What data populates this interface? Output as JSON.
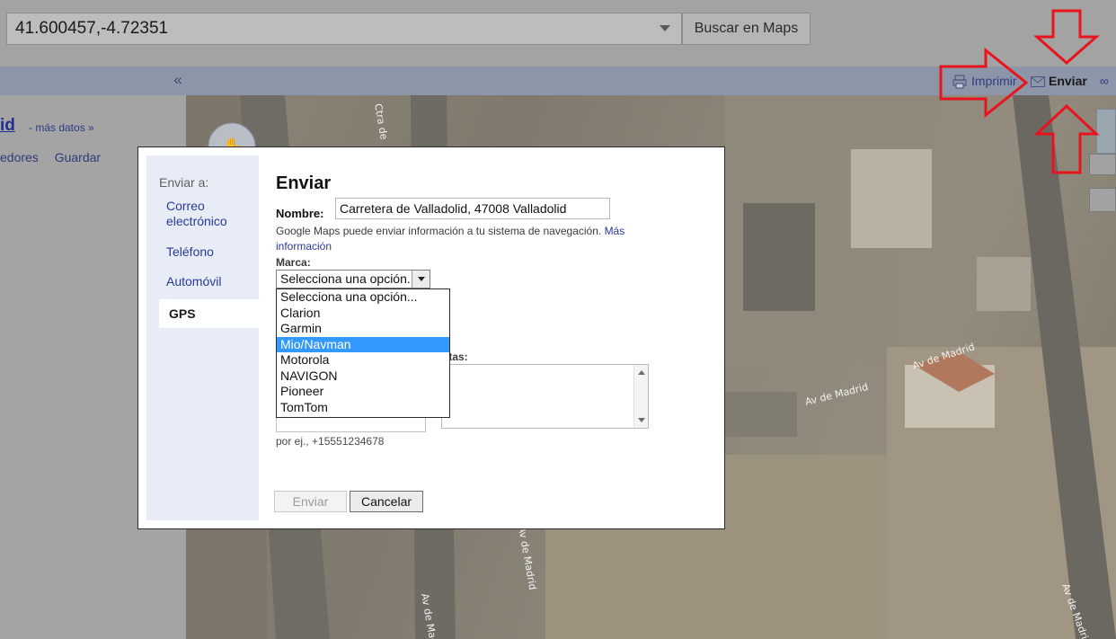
{
  "search": {
    "value": "41.600457,-4.72351",
    "button_label": "Buscar en Maps"
  },
  "sidebar": {
    "collapse_glyph": "«",
    "place_title": "id",
    "more_data_link": "- más datos »",
    "actions": [
      "edores",
      "Guardar"
    ]
  },
  "map_toolbar": {
    "print_label": "Imprimir",
    "send_label": "Enviar",
    "link_glyph": "∞"
  },
  "map_labels": [
    "Av de Madrid",
    "Av de Madrid",
    "Ctra de",
    "Av de Madrid",
    "Av de Madrid",
    "Av de Madrid"
  ],
  "dialog": {
    "title": "Enviar",
    "nav_heading": "Enviar a:",
    "nav_items": [
      "Correo electrónico",
      "Teléfono",
      "Automóvil",
      "GPS"
    ],
    "name_label": "Nombre:",
    "name_value": "Carretera de Valladolid, 47008 Valladolid",
    "info_text": "Google Maps puede enviar información a tu sistema de navegación.",
    "info_link": "Más información",
    "brand_label": "Marca:",
    "brand_selected": "Selecciona una opción...",
    "brand_options": [
      "Selecciona una opción...",
      "Clarion",
      "Garmin",
      "Mio/Navman",
      "Motorola",
      "NAVIGON",
      "Pioneer",
      "TomTom"
    ],
    "highlighted_option": "Mio/Navman",
    "notes_label": "otas:",
    "phone_hint": "por ej., +15551234678",
    "send_button": "Enviar",
    "cancel_button": "Cancelar"
  },
  "colors": {
    "annotation_arrow": "#e8141d",
    "highlight": "#3399ff",
    "link": "#2a3a97"
  }
}
